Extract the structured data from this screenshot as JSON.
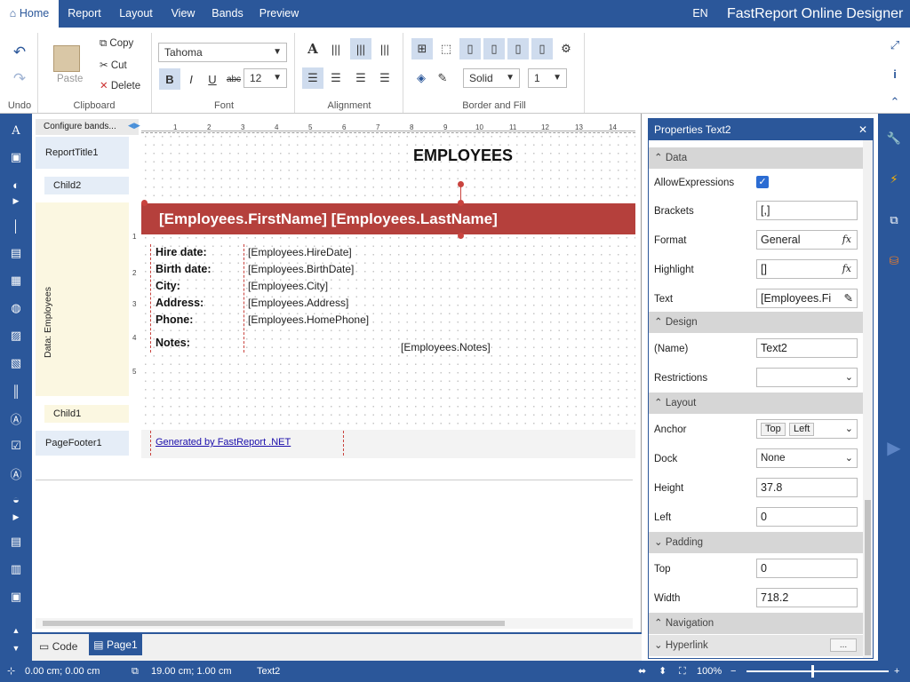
{
  "app": {
    "title": "FastReport Online Designer",
    "lang": "EN"
  },
  "tabs": [
    "Home",
    "Report",
    "Layout",
    "View",
    "Bands",
    "Preview"
  ],
  "ribbon": {
    "undo_label": "Undo",
    "paste": "Paste",
    "copy": "Copy",
    "cut": "Cut",
    "delete": "Delete",
    "clipboard_label": "Clipboard",
    "font_name": "Tahoma",
    "font_size": "12",
    "font_label": "Font",
    "bold": "B",
    "italic": "I",
    "underline": "U",
    "strike": "abc",
    "alignment_label": "Alignment",
    "border_style": "Solid",
    "border_width": "1",
    "border_label": "Border and Fill"
  },
  "bands": {
    "configure": "Configure bands...",
    "items": [
      "ReportTitle1",
      "Child2",
      "Data: Employees",
      "Child1",
      "PageFooter1"
    ]
  },
  "ruler": {
    "h": [
      "1",
      "2",
      "3",
      "4",
      "5",
      "6",
      "7",
      "8",
      "9",
      "10",
      "11",
      "12",
      "13",
      "14"
    ],
    "v": [
      "1",
      "2",
      "3",
      "4",
      "5"
    ]
  },
  "report": {
    "title": "EMPLOYEES",
    "header": "[Employees.FirstName] [Employees.LastName]",
    "labels": [
      "Hire date:",
      "Birth date:",
      "City:",
      "Address:",
      "Phone:"
    ],
    "fields": [
      "[Employees.HireDate]",
      "[Employees.BirthDate]",
      "[Employees.City]",
      "[Employees.Address]",
      "[Employees.HomePhone]"
    ],
    "notes_label": "Notes:",
    "notes_field": "[Employees.Notes]",
    "footer_link": "Generated by FastReport .NET"
  },
  "properties": {
    "title": "Properties Text2",
    "sections": {
      "data": "Data",
      "design": "Design",
      "layout": "Layout",
      "padding": "Padding",
      "navigation": "Navigation",
      "hyperlink": "Hyperlink"
    },
    "rows": {
      "allow_expressions": {
        "name": "AllowExpressions",
        "checked": true
      },
      "brackets": {
        "name": "Brackets",
        "value": "[,]"
      },
      "format": {
        "name": "Format",
        "value": "General"
      },
      "highlight": {
        "name": "Highlight",
        "value": "[]"
      },
      "text": {
        "name": "Text",
        "value": "[Employees.Fi"
      },
      "name": {
        "name": "(Name)",
        "value": "Text2"
      },
      "restrictions": {
        "name": "Restrictions",
        "value": ""
      },
      "anchor": {
        "name": "Anchor",
        "value1": "Top",
        "value2": "Left"
      },
      "dock": {
        "name": "Dock",
        "value": "None"
      },
      "height": {
        "name": "Height",
        "value": "37.8"
      },
      "left": {
        "name": "Left",
        "value": "0"
      },
      "top": {
        "name": "Top",
        "value": "0"
      },
      "width": {
        "name": "Width",
        "value": "718.2"
      }
    },
    "fx": "fx",
    "ellipsis": "..."
  },
  "bottom_tabs": {
    "code": "Code",
    "page": "Page1"
  },
  "status": {
    "position": "0.00 cm; 0.00 cm",
    "size": "19.00 cm; 1.00 cm",
    "object": "Text2",
    "zoom": "100%"
  },
  "colors": {
    "accent": "#2b579a",
    "header_band": "#b5403c",
    "band_bg": "#fbf7e1"
  }
}
